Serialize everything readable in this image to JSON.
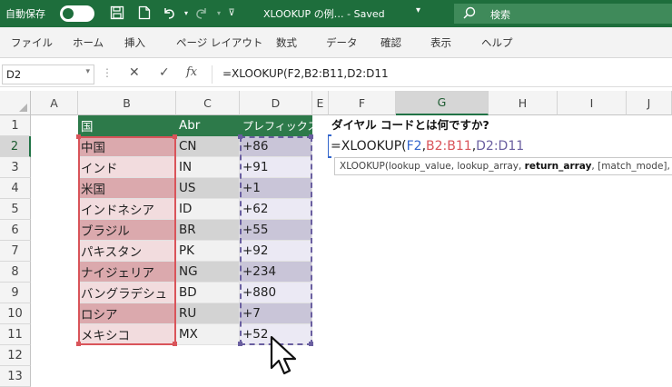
{
  "titlebar": {
    "autosave_label": "自動保存",
    "title": "XLOOKUP の例… - Saved",
    "search_label": "検索"
  },
  "ribbon": {
    "tabs": [
      "ファイル",
      "ホーム",
      "挿入",
      "ページ レイアウト",
      "数式",
      "データ",
      "確認",
      "表示",
      "ヘルプ"
    ]
  },
  "formula_bar": {
    "name_box": "D2",
    "formula": "=XLOOKUP(F2,B2:B11,D2:D11"
  },
  "grid": {
    "columns": [
      "A",
      "B",
      "C",
      "D",
      "E",
      "F",
      "G",
      "H",
      "I",
      "J"
    ],
    "selected_column": "G",
    "rows": [
      "1",
      "2",
      "3",
      "4",
      "5",
      "6",
      "7",
      "8",
      "9",
      "10",
      "11",
      "12",
      "13"
    ],
    "selected_row": "2",
    "table_headers": {
      "country": "国",
      "abbr": "Abr",
      "prefix": "プレフィックス"
    },
    "table_rows": [
      {
        "country": "中国",
        "abbr": "CN",
        "prefix": "+86"
      },
      {
        "country": "インド",
        "abbr": "IN",
        "prefix": "+91"
      },
      {
        "country": "米国",
        "abbr": "US",
        "prefix": "+1"
      },
      {
        "country": "インドネシア",
        "abbr": "ID",
        "prefix": "+62"
      },
      {
        "country": "ブラジル",
        "abbr": "BR",
        "prefix": "+55"
      },
      {
        "country": "パキスタン",
        "abbr": "PK",
        "prefix": "+92"
      },
      {
        "country": "ナイジェリア",
        "abbr": "NG",
        "prefix": "+234"
      },
      {
        "country": "バングラデシュ",
        "abbr": "BD",
        "prefix": "+880"
      },
      {
        "country": "ロシア",
        "abbr": "RU",
        "prefix": "+7"
      },
      {
        "country": "メキシコ",
        "abbr": "MX",
        "prefix": "+52"
      }
    ],
    "question": "ダイヤル コードとは何ですか?",
    "edit": {
      "prefix": "=XLOOKUP(",
      "arg1": "F2",
      "comma1": ",",
      "arg2": "B2:B11",
      "comma2": ",",
      "arg3": "D2:D11"
    },
    "tooltip": {
      "part1": "XLOOKUP(lookup_value, lookup_array, ",
      "bold": "return_array",
      "part2": ", [match_mode], [se"
    }
  },
  "colors": {
    "accent": "#217346",
    "header_fill": "#2d7a4a",
    "ref_f2": "#3366cc",
    "ref_b": "#d9545a",
    "ref_d": "#6a5fa0"
  },
  "icons": [
    "save-icon",
    "file-icon",
    "undo-icon",
    "redo-icon",
    "customize-icon",
    "search-icon",
    "dropdown-icon",
    "cancel-icon",
    "enter-icon",
    "fx-icon",
    "mouse-cursor-icon"
  ]
}
